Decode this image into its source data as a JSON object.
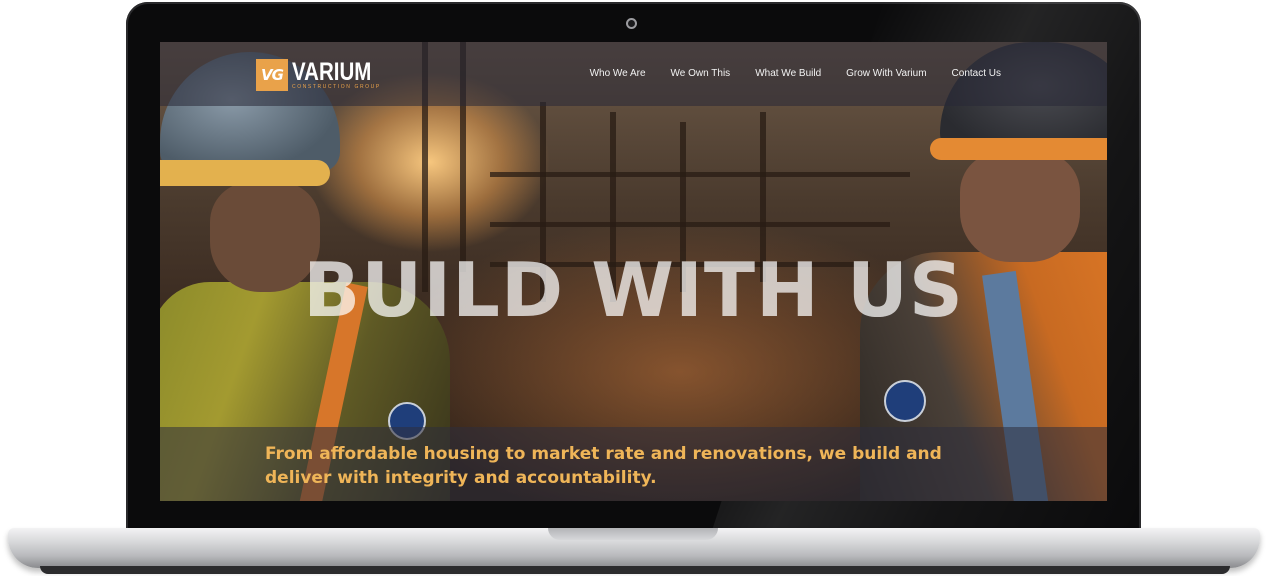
{
  "brand": {
    "mark": "VG",
    "name": "VARIUM",
    "tagline": "CONSTRUCTION GROUP",
    "accent_color": "#e9a24a"
  },
  "nav": {
    "items": [
      {
        "label": "Who We Are"
      },
      {
        "label": "We Own This"
      },
      {
        "label": "What We Build"
      },
      {
        "label": "Grow With Varium"
      },
      {
        "label": "Contact Us"
      }
    ]
  },
  "hero": {
    "title": "BUILD WITH US",
    "subtitle_line1": "From affordable housing to market rate and renovations, we build and",
    "subtitle_line2": "deliver with integrity and accountability.",
    "subtitle_color": "#efb558"
  },
  "icons": {
    "camera": "webcam-icon",
    "logo": "varium-logo-icon"
  }
}
